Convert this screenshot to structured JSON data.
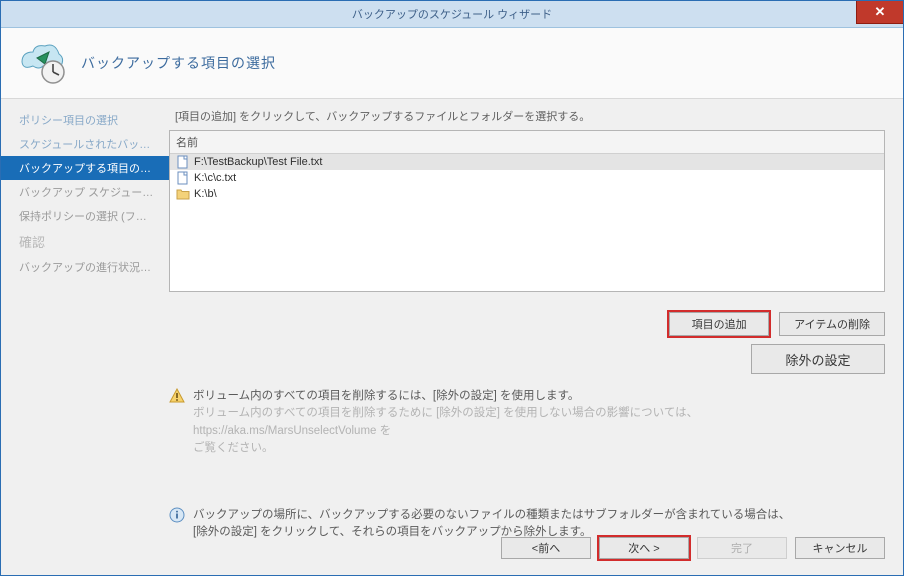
{
  "window": {
    "title": "バックアップのスケジュール ウィザード"
  },
  "header": {
    "heading": "バックアップする項目の選択"
  },
  "sidebar": {
    "items": [
      {
        "label": "ポリシー項目の選択",
        "state": "visited"
      },
      {
        "label": "スケジュールされたバックアップの…",
        "state": "visited"
      },
      {
        "label": "バックアップする項目の選択",
        "state": "active"
      },
      {
        "label": "バックアップ スケジュールの選択…",
        "state": "pending"
      },
      {
        "label": "保持ポリシーの選択 (フ…",
        "state": "pending"
      },
      {
        "label": "確認",
        "state": "dim"
      },
      {
        "label": "バックアップの進行状況の変更",
        "state": "pending"
      }
    ]
  },
  "main": {
    "instruction": "[項目の追加] をクリックして、バックアップするファイルとフォルダーを選択する。",
    "list_header": "名前",
    "items": [
      {
        "icon": "file",
        "path": "F:\\TestBackup\\Test File.txt",
        "selected": true
      },
      {
        "icon": "file",
        "path": "K:\\c\\c.txt",
        "selected": false
      },
      {
        "icon": "folder",
        "path": "K:\\b\\",
        "selected": false
      }
    ],
    "buttons": {
      "add": "項目の追加",
      "remove": "アイテムの削除",
      "exclude": "除外の設定"
    },
    "note1": {
      "line1": "ボリューム内のすべての項目を削除するには、[除外の設定] を使用します。",
      "line2a": "ボリューム内のすべての項目を削除するために [除外の設定] を使用しない場合の影響については、https://aka.ms/MarsUnselectVolume を",
      "line2b": "ご覧ください。"
    },
    "note2": {
      "line1": "バックアップの場所に、バックアップする必要のないファイルの種類またはサブフォルダーが含まれている場合は、",
      "line2": "[除外の設定] をクリックして、それらの項目をバックアップから除外します。"
    }
  },
  "nav": {
    "back": "<前へ",
    "next": "次へ >",
    "finish": "完了",
    "cancel": "キャンセル"
  }
}
